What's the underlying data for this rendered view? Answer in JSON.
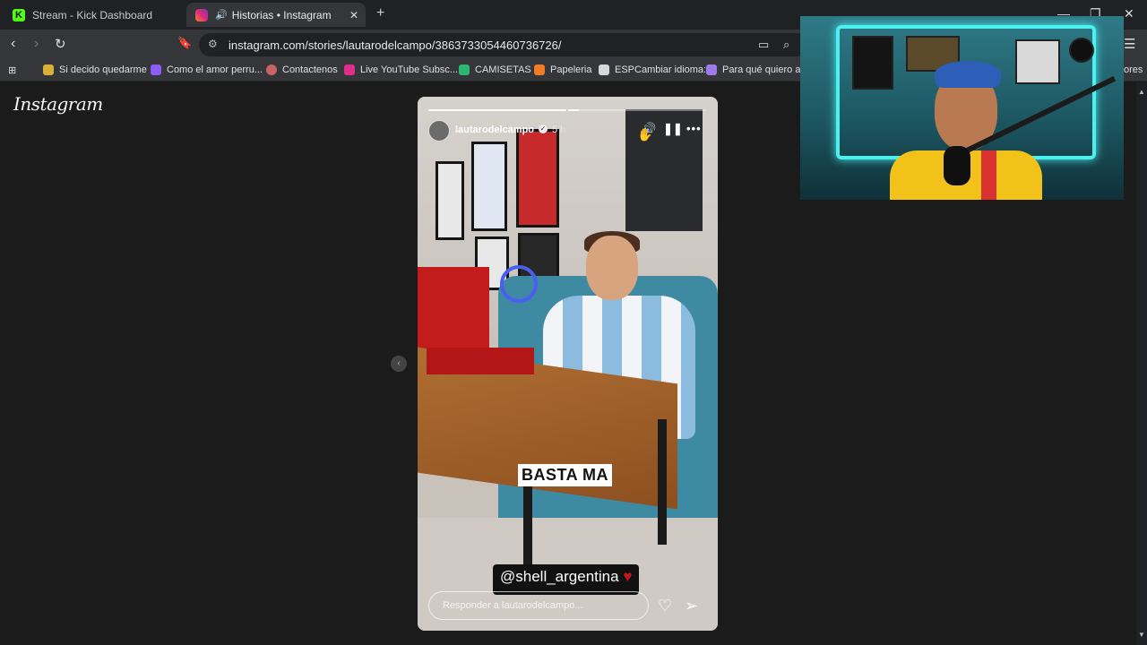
{
  "tabs": [
    {
      "title": "Stream - Kick Dashboard",
      "icon": "kick-icon"
    },
    {
      "title": "Historias • Instagram",
      "icon": "instagram-icon",
      "audio": "speaker-icon"
    }
  ],
  "toolbar": {
    "url": "instagram.com/stories/lautarodelcampo/3863733054460736726/"
  },
  "bookmarks": [
    "Si decido quedarme",
    "Como el amor perru...",
    "Contactenos",
    "Live YouTube Subsc...",
    "CAMISETAS",
    "Papeleria",
    "ESPCambiar idioma:",
    "Para qué quiero asp",
    "ores"
  ],
  "page": {
    "logo": "Instagram"
  },
  "story": {
    "username": "lautarodelcampo",
    "time": "5 h",
    "caption": "BASTA MA",
    "mention": "@shell_argentina",
    "reply_placeholder": "Responder a lautarodelcampo...",
    "progress": [
      1.0,
      0.08,
      0.0
    ],
    "colors": {
      "mention_bg": "#111111",
      "heart": "#c4161c"
    }
  }
}
